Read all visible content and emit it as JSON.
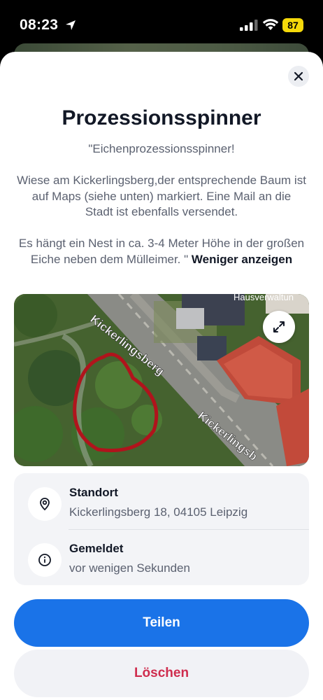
{
  "status_bar": {
    "time": "08:23",
    "battery": "87"
  },
  "detail": {
    "close_icon": "close-icon",
    "title": "Prozessionsspinner",
    "description": "\"Eichenprozessionsspinner!\n\nWiese am Kickerlingsberg,der entsprechende Baum ist auf Maps (siehe unten) markiert. Eine Mail an die Stadt ist ebenfalls versendet.\n\nEs hängt ein Nest in ca. 3-4 Meter Höhe in der großen Eiche neben dem Mülleimer. \"",
    "show_less": "Weniger anzeigen"
  },
  "map": {
    "street_label_1": "Kickerlingsberg",
    "street_label_2": "Kickerlingsb",
    "poi_label": "Hausverwaltun",
    "expand_icon": "expand-icon",
    "marker_color": "#b0141c"
  },
  "info": {
    "location_label": "Standort",
    "location_value": "Kickerlingsberg 18, 04105 Leipzig",
    "location_icon": "map-pin-icon",
    "reported_label": "Gemeldet",
    "reported_value": "vor wenigen Sekunden",
    "reported_icon": "info-icon"
  },
  "actions": {
    "share_label": "Teilen",
    "delete_label": "Löschen"
  },
  "colors": {
    "primary": "#1a73e8",
    "danger": "#cf2d4e",
    "battery": "#f5d90a"
  }
}
